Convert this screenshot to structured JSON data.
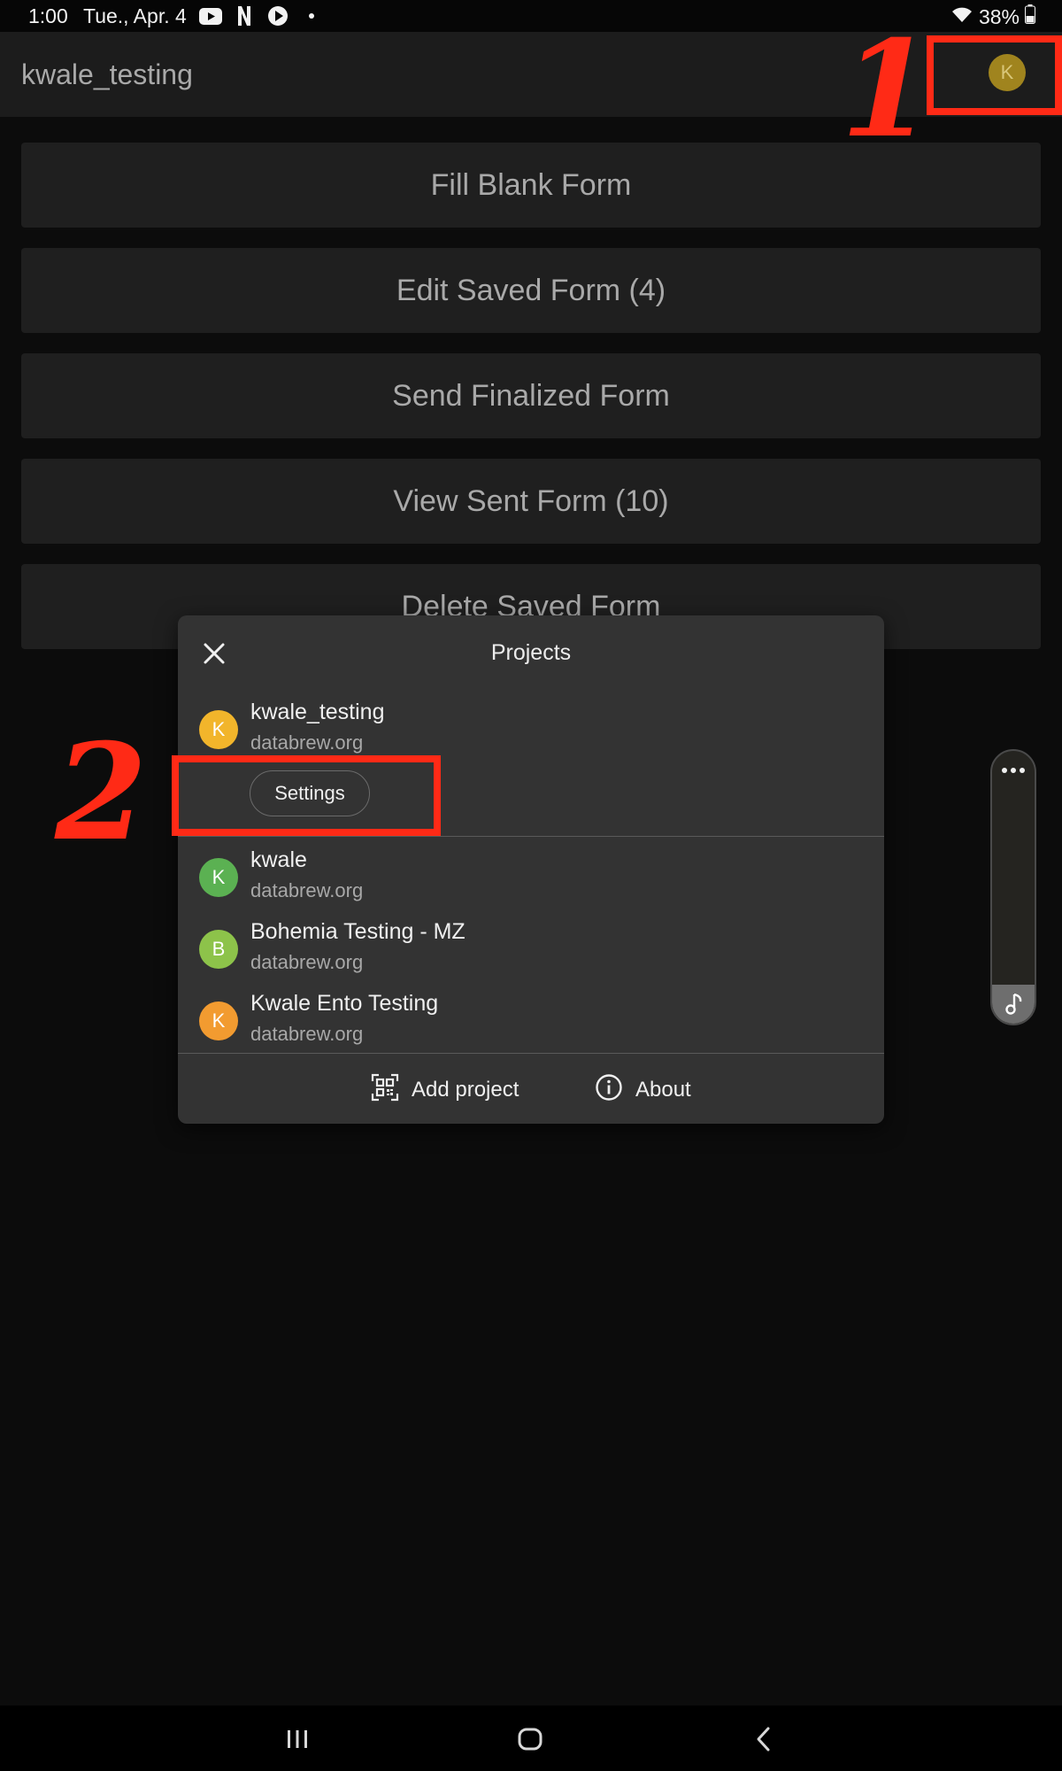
{
  "status_bar": {
    "time": "1:00",
    "date": "Tue., Apr. 4",
    "notification_icons": [
      "youtube-icon",
      "netflix-icon",
      "play-icon",
      "dot-icon"
    ],
    "battery": "38%"
  },
  "app_bar": {
    "title": "kwale_testing",
    "avatar_letter": "K"
  },
  "menu": {
    "fill_blank": "Fill Blank Form",
    "edit_saved": "Edit Saved Form (4)",
    "send_finalized": "Send Finalized Form",
    "view_sent": "View Sent Form (10)",
    "delete_saved": "Delete Saved Form"
  },
  "annotations": {
    "step1": "1",
    "step2": "2"
  },
  "dialog": {
    "title": "Projects",
    "current": {
      "letter": "K",
      "name": "kwale_testing",
      "url": "databrew.org",
      "color": "#f2b52b"
    },
    "settings_label": "Settings",
    "projects": [
      {
        "letter": "K",
        "name": "kwale",
        "url": "databrew.org",
        "color": "#5bb152"
      },
      {
        "letter": "B",
        "name": "Bohemia Testing - MZ",
        "url": "databrew.org",
        "color": "#8dc34a"
      },
      {
        "letter": "K",
        "name": "Kwale Ento Testing",
        "url": "databrew.org",
        "color": "#f29b30"
      }
    ],
    "add_project_label": "Add project",
    "about_label": "About"
  },
  "colors": {
    "annotation_red": "#ff2a16",
    "background": "#0c0c0c",
    "dialog_bg": "#333333"
  }
}
